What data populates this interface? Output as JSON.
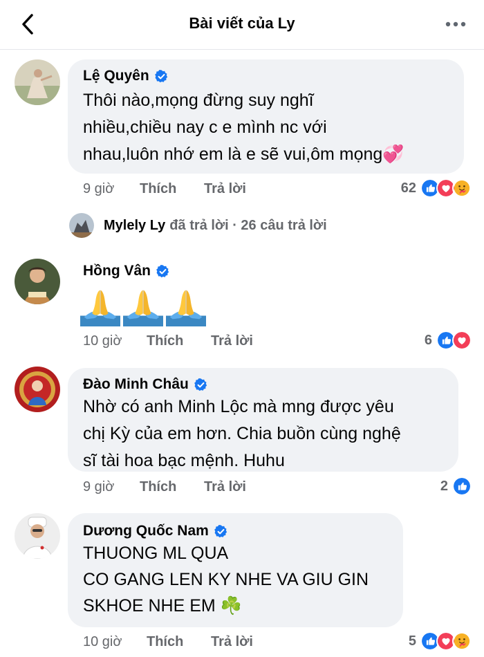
{
  "header": {
    "title": "Bài viết của Ly"
  },
  "comments": [
    {
      "author": "Lệ Quyên",
      "text": "Thôi nào,mọng đừng suy nghĩ\nnhiều,chiều nay c e mình nc với\nnhau,luôn nhớ em là e sẽ vui,ôm mọng💞",
      "time": "9 giờ",
      "like_label": "Thích",
      "reply_label": "Trả lời",
      "reaction_count": "62",
      "reactions": [
        "like",
        "love",
        "care"
      ]
    },
    {
      "author": "Hồng Vân",
      "text": "🙏🙏🙏",
      "time": "10 giờ",
      "like_label": "Thích",
      "reply_label": "Trả lời",
      "reaction_count": "6",
      "reactions": [
        "like",
        "love"
      ]
    },
    {
      "author": "Đào Minh Châu",
      "text": "Nhờ có anh Minh Lộc mà mng được yêu\nchị Kỳ của em hơn. Chia buồn cùng nghệ\nsĩ tài hoa bạc mệnh. Huhu",
      "time": "9 giờ",
      "like_label": "Thích",
      "reply_label": "Trả lời",
      "reaction_count": "2",
      "reactions": [
        "like"
      ]
    },
    {
      "author": "Dương Quốc Nam",
      "text": "THUONG ML QUA\nCO GANG LEN KY NHE VA GIU GIN\nSKHOE NHE EM ☘️",
      "time": "10 giờ",
      "like_label": "Thích",
      "reply_label": "Trả lời",
      "reaction_count": "5",
      "reactions": [
        "like",
        "love",
        "care"
      ]
    }
  ],
  "reply_summary": {
    "name": "Mylely Ly",
    "text": "đã trả lời · 26 câu trả lời"
  },
  "icons": {
    "back": "chevron-left-icon",
    "more": "more-horizontal-icon",
    "verified": "verified-badge-icon"
  },
  "colors": {
    "bubble": "#f0f2f5",
    "verified": "#1877f2",
    "like": "#1877f2",
    "love": "#f33e58",
    "care": "#f7b125",
    "meta": "#65676b"
  }
}
